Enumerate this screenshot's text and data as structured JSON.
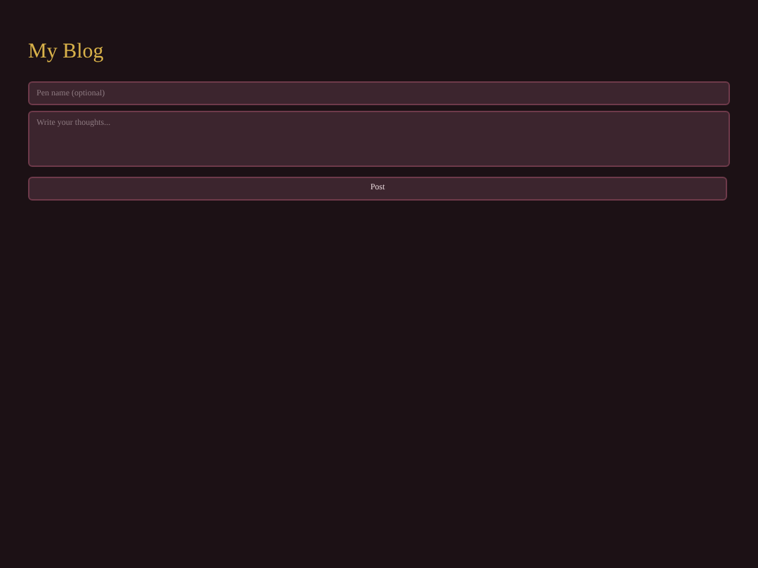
{
  "title": "My Blog",
  "pen_name": {
    "placeholder": "Pen name (optional)"
  },
  "message": {
    "placeholder": "Write your thoughts..."
  },
  "button": "Post"
}
